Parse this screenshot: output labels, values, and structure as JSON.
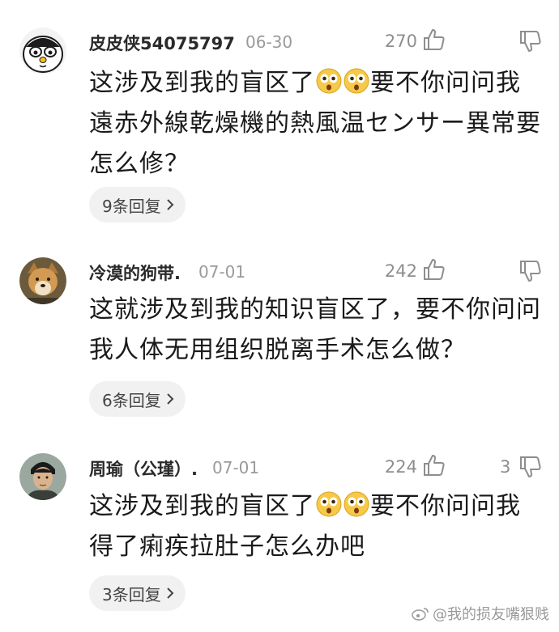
{
  "comments": [
    {
      "username": "皮皮侠54075797",
      "date": "06-30",
      "likes": "270",
      "dislikes": "",
      "text_before_emoji": "这涉及到我的盲区了",
      "text_after_emoji": "要不你问问我遠赤外線乾燥機的熱風温センサー異常要怎么修？",
      "replies_label": "9条回复"
    },
    {
      "username": "冷漠的狗带.",
      "date": "07-01",
      "likes": "242",
      "dislikes": "",
      "text": "这就涉及到我的知识盲区了，要不你问问我人体无用组织脱离手术怎么做？",
      "replies_label": "6条回复"
    },
    {
      "username": "周瑜（公瑾）.",
      "date": "07-01",
      "likes": "224",
      "dislikes": "3",
      "text_before_emoji": "这涉及到我的盲区了",
      "text_after_emoji": "要不你问问我得了痢疾拉肚子怎么办吧",
      "replies_label": "3条回复"
    }
  ],
  "watermark": "@我的损友嘴狠贱",
  "icons": {
    "like": "thumb-up-icon",
    "dislike": "thumb-down-icon",
    "emoji": "surprised-face-emoji",
    "chevron": "chevron-right-icon"
  },
  "colors": {
    "background": "#ffffff",
    "text": "#1a1a1a",
    "muted": "#9a9a9a",
    "pill": "#f1f1f1"
  }
}
